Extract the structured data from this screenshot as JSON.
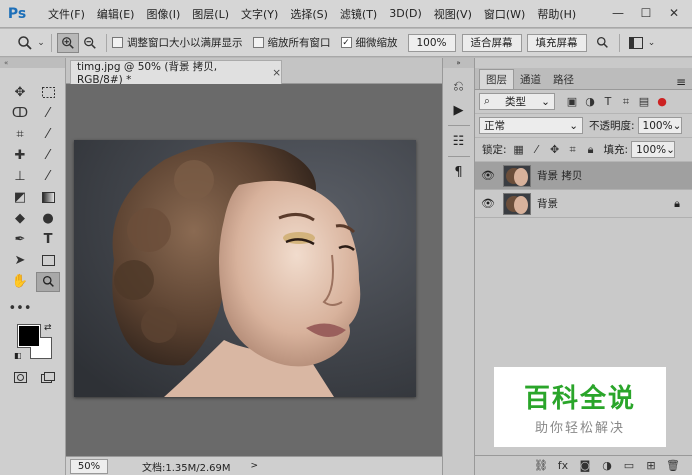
{
  "app": {
    "logo": "Ps"
  },
  "menu": [
    "文件(F)",
    "编辑(E)",
    "图像(I)",
    "图层(L)",
    "文字(Y)",
    "选择(S)",
    "滤镜(T)",
    "3D(D)",
    "视图(V)",
    "窗口(W)",
    "帮助(H)"
  ],
  "window_controls": {
    "minimize": "—",
    "maximize": "☐",
    "close": "✕"
  },
  "options": {
    "resize_windows": "调整窗口大小以满屏显示",
    "zoom_all": "缩放所有窗口",
    "scrubby_zoom": "细微缩放",
    "zoom_value": "100%",
    "fit_screen": "适合屏幕",
    "fill_screen": "填充屏幕",
    "resize_checked": false,
    "zoom_all_checked": false,
    "scrubby_checked": true
  },
  "document": {
    "tab_title": "timg.jpg @ 50% (背景 拷贝, RGB/8#) *",
    "close": "×"
  },
  "status": {
    "zoom": "50%",
    "doc_info": "文档:1.35M/2.69M",
    "arrow": ">"
  },
  "layers_panel": {
    "tabs": [
      "图层",
      "通道",
      "路径"
    ],
    "menu_icon": "≡",
    "filter_kind": "类型",
    "blend_mode": "正常",
    "opacity_label": "不透明度:",
    "opacity_value": "100%",
    "lock_label": "锁定:",
    "fill_label": "填充:",
    "fill_value": "100%",
    "layers": [
      {
        "name": "背景 拷贝",
        "selected": true,
        "locked": false
      },
      {
        "name": "背景",
        "selected": false,
        "locked": true
      }
    ],
    "footer_fx": "fx"
  },
  "watermark": {
    "title": "百科全说",
    "subtitle": "助你轻松解决"
  }
}
